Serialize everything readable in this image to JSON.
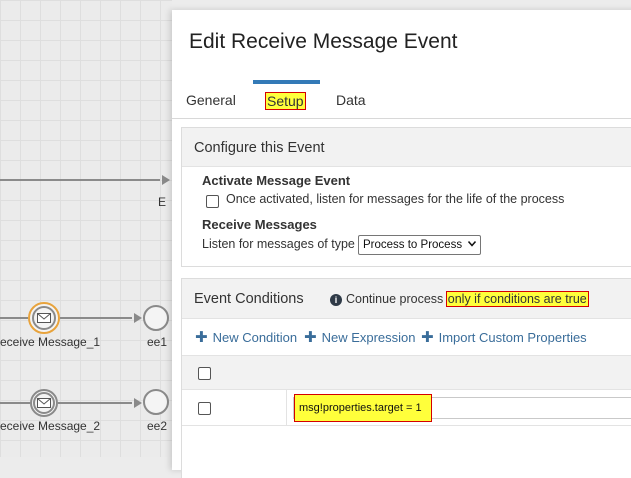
{
  "canvas": {
    "partial_label": "E",
    "event1_label": "eceive Message_1",
    "event2_label": "eceive Message_2",
    "end1_label": "ee1",
    "end2_label": "ee2"
  },
  "dialog": {
    "title": "Edit Receive Message Event",
    "tabs": [
      {
        "label": "General"
      },
      {
        "label": "Setup"
      },
      {
        "label": "Data"
      }
    ],
    "active_tab": "Setup"
  },
  "configure": {
    "header": "Configure this Event",
    "activate_label": "Activate Message Event",
    "once_activated_text": "Once activated, listen for messages for the life of the process",
    "once_activated_checked": false,
    "receive_label": "Receive Messages",
    "listen_text": "Listen for messages of type",
    "message_type_selected": "Process to Process"
  },
  "conditions": {
    "header": "Event Conditions",
    "info_prefix": "Continue process",
    "info_highlight": "only if conditions are true",
    "actions": {
      "new_condition": "New Condition",
      "new_expression": "New Expression",
      "import_props": "Import Custom Properties"
    },
    "rows": [
      {
        "expression": "msg!properties.target = 1",
        "checked": false
      }
    ],
    "select_all_checked": false
  },
  "colors": {
    "accent": "#337ab7",
    "highlight": "#ffff3b",
    "highlight_border": "#d40000",
    "link": "#3a6d9a"
  }
}
